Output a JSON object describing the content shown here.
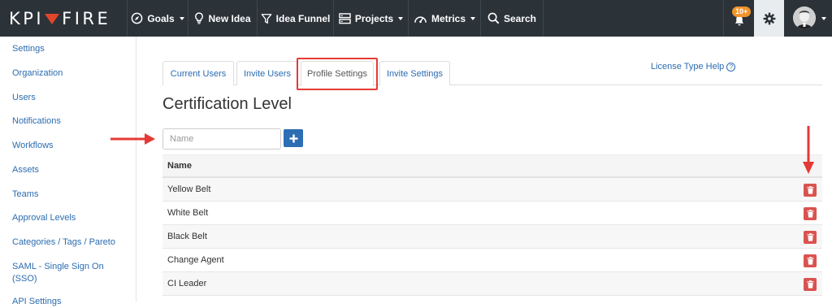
{
  "brand": {
    "name_left": "KPI",
    "name_right": "FIRE"
  },
  "nav": {
    "goals": "Goals",
    "new_idea": "New Idea",
    "idea_funnel": "Idea Funnel",
    "projects": "Projects",
    "metrics": "Metrics",
    "search": "Search",
    "notification_badge": "10+"
  },
  "sidebar": {
    "items": [
      {
        "label": "Settings"
      },
      {
        "label": "Organization"
      },
      {
        "label": "Users"
      },
      {
        "label": "Notifications"
      },
      {
        "label": "Workflows"
      },
      {
        "label": "Assets"
      },
      {
        "label": "Teams"
      },
      {
        "label": "Approval Levels"
      },
      {
        "label": "Categories / Tags / Pareto"
      },
      {
        "label": "SAML - Single Sign On (SSO)"
      },
      {
        "label": "API Settings"
      }
    ]
  },
  "tabs": [
    {
      "label": "Current Users"
    },
    {
      "label": "Invite Users"
    },
    {
      "label": "Profile Settings"
    },
    {
      "label": "Invite Settings"
    }
  ],
  "license_help": "License Type Help",
  "page_title": "Certification Level",
  "name_input": {
    "placeholder": "Name",
    "value": ""
  },
  "table": {
    "header": "Name",
    "rows": [
      {
        "name": "Yellow Belt"
      },
      {
        "name": "White Belt"
      },
      {
        "name": "Black Belt"
      },
      {
        "name": "Change Agent"
      },
      {
        "name": "CI Leader"
      }
    ]
  },
  "colors": {
    "topbar": "#2b3238",
    "link": "#2b6cb0",
    "primary_button": "#2c6db3",
    "delete_button": "#d9534f",
    "annotation_red": "#e53935",
    "badge": "#f0932b"
  },
  "icons": {
    "goals": "compass-icon",
    "new_idea": "lightbulb-icon",
    "idea_funnel": "funnel-icon",
    "projects": "server-icon",
    "metrics": "gauge-icon",
    "search": "search-icon",
    "bell": "bell-icon",
    "settings": "gear-icon",
    "add": "plus-icon",
    "delete": "trash-icon"
  }
}
